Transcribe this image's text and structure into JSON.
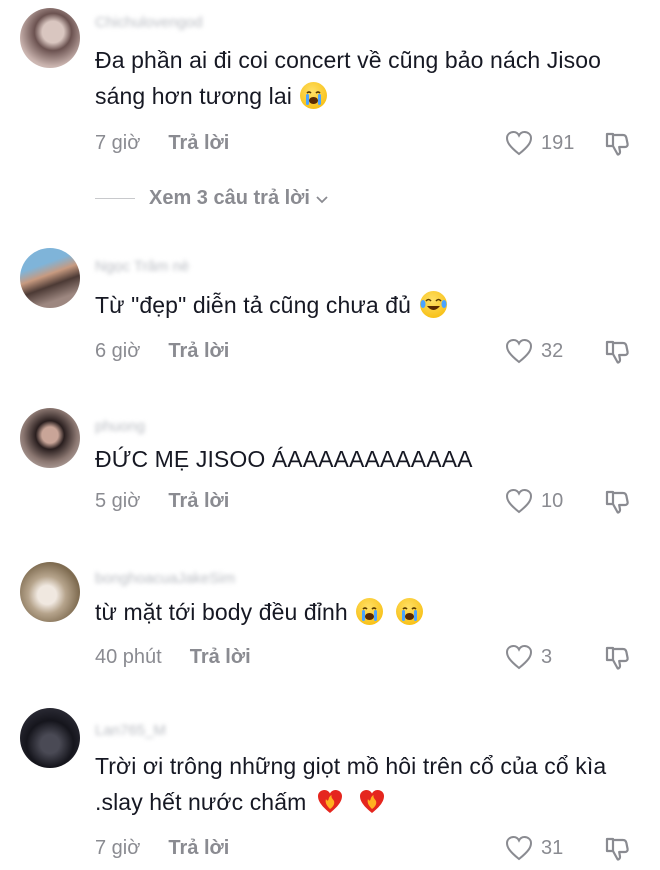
{
  "comments": [
    {
      "username": "Chichulovengod",
      "text": "Đa phần ai đi coi concert về cũng bảo nách Jisoo sáng hơn tương lai",
      "emoji": "loudly-crying-face",
      "time": "7 giờ",
      "reply": "Trả lời",
      "likes": "191"
    },
    {
      "username": "Ngọc Trâm nè",
      "text": "Từ \"đẹp\" diễn tả cũng chưa đủ",
      "emoji": "face-with-tears-of-joy",
      "time": "6 giờ",
      "reply": "Trả lời",
      "likes": "32"
    },
    {
      "username": "phuong",
      "text": "ĐỨC MẸ JISOO ÁAAAAAAAAAAAA",
      "time": "5 giờ",
      "reply": "Trả lời",
      "likes": "10"
    },
    {
      "username": "bonghoacuaJakeSim",
      "text": "từ mặt tới body đều đỉnh",
      "emoji": "loudly-crying-face",
      "time": "40 phút",
      "reply": "Trả lời",
      "likes": "3"
    },
    {
      "username": "Lan765_M",
      "text": "Trời ơi trông những giọt mồ hôi trên cổ của cổ kìa .slay hết nước chấm",
      "emoji": "heart-on-fire",
      "time": "7 giờ",
      "reply": "Trả lời",
      "likes": "31"
    }
  ],
  "see_more": "Xem 3 câu trả lời",
  "colors": {
    "text": "#161823",
    "muted": "#8a8b91",
    "background": "#ffffff"
  }
}
